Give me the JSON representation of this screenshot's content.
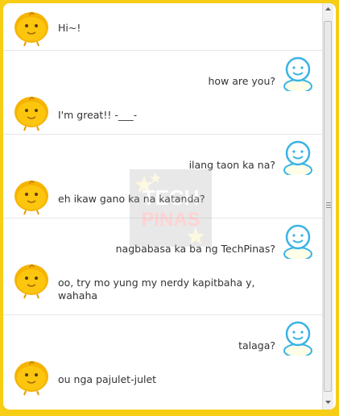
{
  "conversation": [
    {
      "bot": "Hi~!"
    },
    {
      "user": "how are you?",
      "bot": "I'm great!! -___-"
    },
    {
      "user": "ilang taon ka na?",
      "bot": "eh ikaw gano ka na katanda?"
    },
    {
      "user": "nagbabasa ka ba ng TechPinas?",
      "bot": "oo, try mo yung my nerdy kapitbaha y, wahaha"
    },
    {
      "user": "talaga?",
      "bot": "ou nga pajulet-julet"
    }
  ],
  "watermark": {
    "line1": "TECH",
    "line2": "PINAS"
  },
  "colors": {
    "frame": "#f7cd16",
    "bot_avatar": "#f6b300",
    "user_avatar": "#39b3e4"
  },
  "icons": {
    "bot_avatar": "simsimi-chick-icon",
    "user_avatar": "smiley-user-icon",
    "scroll_up": "arrow-up-icon",
    "scroll_down": "arrow-down-icon"
  }
}
